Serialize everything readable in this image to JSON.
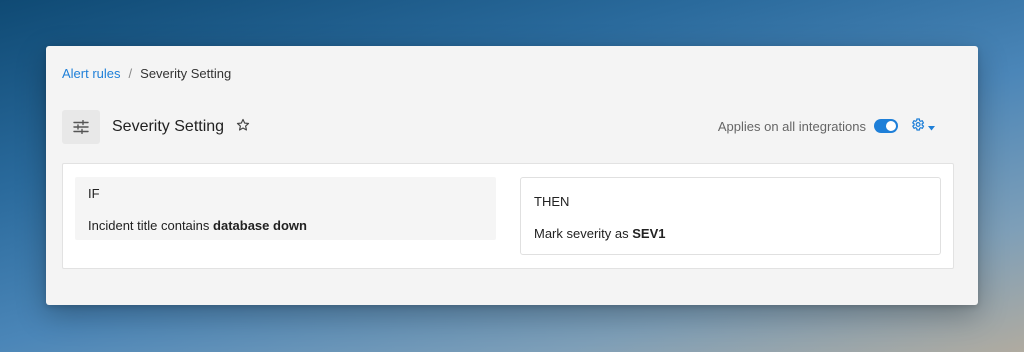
{
  "breadcrumb": {
    "parent": "Alert rules",
    "separator": "/",
    "current": "Severity Setting"
  },
  "header": {
    "icon": "sliders-icon",
    "title": "Severity Setting",
    "star_icon": "star-outline-icon",
    "applies_text": "Applies on all integrations",
    "toggle_on": true,
    "settings_icon": "gear-icon"
  },
  "rule": {
    "if": {
      "heading": "IF",
      "prefix": "Incident title contains",
      "value": "database down"
    },
    "then": {
      "heading": "THEN",
      "prefix": "Mark severity as",
      "value": "SEV1"
    }
  },
  "colors": {
    "accent": "#1e7fd8",
    "window_bg": "#f4f4f4",
    "if_bg": "#f5f5f5"
  }
}
